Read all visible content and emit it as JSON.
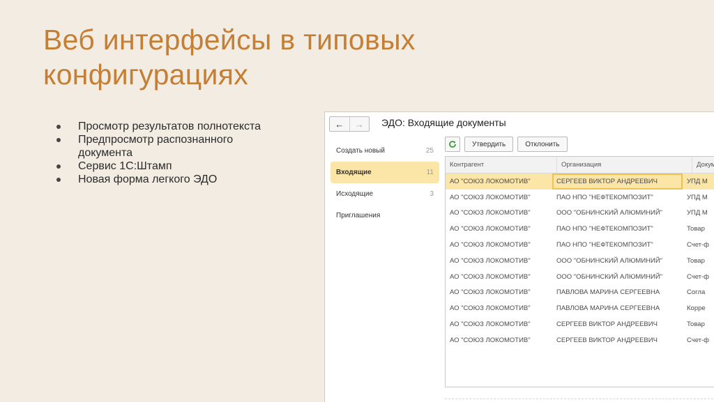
{
  "slide": {
    "title_lines": [
      "Веб интерфейсы в типовых",
      "конфигурациях"
    ],
    "bullets": [
      [
        "Просмотр результатов полнотекста"
      ],
      [
        "Предпросмотр распознанного",
        "документа"
      ],
      [
        "Сервис 1С:Штамп"
      ],
      [
        "Новая форма легкого ЭДО"
      ]
    ]
  },
  "window": {
    "back_glyph": "←",
    "forward_glyph": "→",
    "title": "ЭДО: Входящие документы"
  },
  "sidebar": {
    "items": [
      {
        "label": "Создать новый",
        "count": "25"
      },
      {
        "label": "Входящие",
        "count": "11"
      },
      {
        "label": "Исходящие",
        "count": "3"
      },
      {
        "label": "Приглашения",
        "count": ""
      }
    ]
  },
  "toolbar": {
    "refresh_icon": "refresh-icon",
    "refresh_glyph": "↻",
    "approve_label": "Утвердить",
    "reject_label": "Отклонить"
  },
  "table": {
    "columns": [
      "Контрагент",
      "Организация",
      "Докум"
    ],
    "rows": [
      [
        "АО \"СОЮЗ ЛОКОМОТИВ\"",
        "СЕРГЕЕВ ВИКТОР АНДРЕЕВИЧ",
        "УПД М"
      ],
      [
        "АО \"СОЮЗ ЛОКОМОТИВ\"",
        "ПАО НПО \"НЕФТЕКОМПОЗИТ\"",
        "УПД М"
      ],
      [
        "АО \"СОЮЗ ЛОКОМОТИВ\"",
        "ООО \"ОБНИНСКИЙ АЛЮМИНИЙ\"",
        "УПД М"
      ],
      [
        "АО \"СОЮЗ ЛОКОМОТИВ\"",
        "ПАО НПО \"НЕФТЕКОМПОЗИТ\"",
        "Товар"
      ],
      [
        "АО \"СОЮЗ ЛОКОМОТИВ\"",
        "ПАО НПО \"НЕФТЕКОМПОЗИТ\"",
        "Счет-ф"
      ],
      [
        "АО \"СОЮЗ ЛОКОМОТИВ\"",
        "ООО \"ОБНИНСКИЙ АЛЮМИНИЙ\"",
        "Товар"
      ],
      [
        "АО \"СОЮЗ ЛОКОМОТИВ\"",
        "ООО \"ОБНИНСКИЙ АЛЮМИНИЙ\"",
        "Счет-ф"
      ],
      [
        "АО \"СОЮЗ ЛОКОМОТИВ\"",
        "ПАВЛОВА МАРИНА СЕРГЕЕВНА",
        "Согла"
      ],
      [
        "АО \"СОЮЗ ЛОКОМОТИВ\"",
        "ПАВЛОВА МАРИНА СЕРГЕЕВНА",
        "Корре"
      ],
      [
        "АО \"СОЮЗ ЛОКОМОТИВ\"",
        "СЕРГЕЕВ ВИКТОР АНДРЕЕВИЧ",
        "Товар"
      ],
      [
        "АО \"СОЮЗ ЛОКОМОТИВ\"",
        "СЕРГЕЕВ ВИКТОР АНДРЕЕВИЧ",
        "Счет-ф"
      ]
    ]
  },
  "colors": {
    "title": "#c57f35",
    "background": "#f2ece2",
    "selection": "#fbe5a7",
    "refresh": "#3aa036"
  }
}
